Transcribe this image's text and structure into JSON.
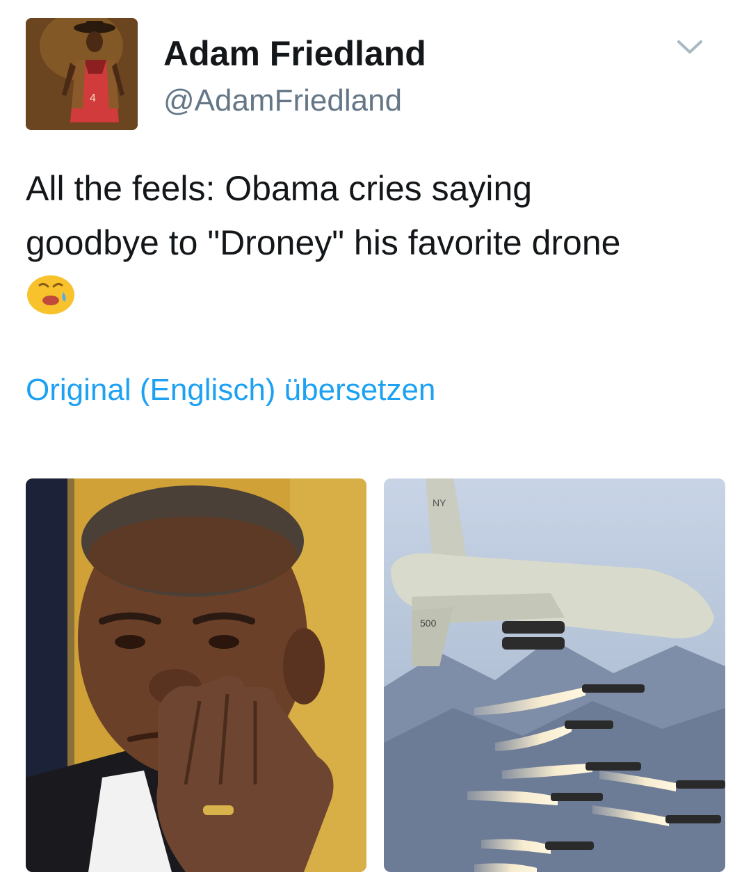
{
  "tweet": {
    "display_name": "Adam Friedland",
    "handle": "@AdamFriedland",
    "text_line_1": "All the feels: Obama cries saying",
    "text_line_2": "goodbye to \"Droney\" his favorite drone",
    "emoji": "sad-crying-face-emoji",
    "translate_link": "Original (Englisch) übersetzen",
    "menu_icon": "chevron-down-icon"
  },
  "media": {
    "count": 2,
    "photo_1": {
      "subject": "crying man wiping tears"
    },
    "photo_2": {
      "subject": "drone firing missiles",
      "tail_marking": "NY",
      "number_marking": "500"
    }
  },
  "colors": {
    "text_primary": "#14171a",
    "text_secondary": "#657786",
    "link": "#1da1f2",
    "emoji": "#f7c22c"
  }
}
